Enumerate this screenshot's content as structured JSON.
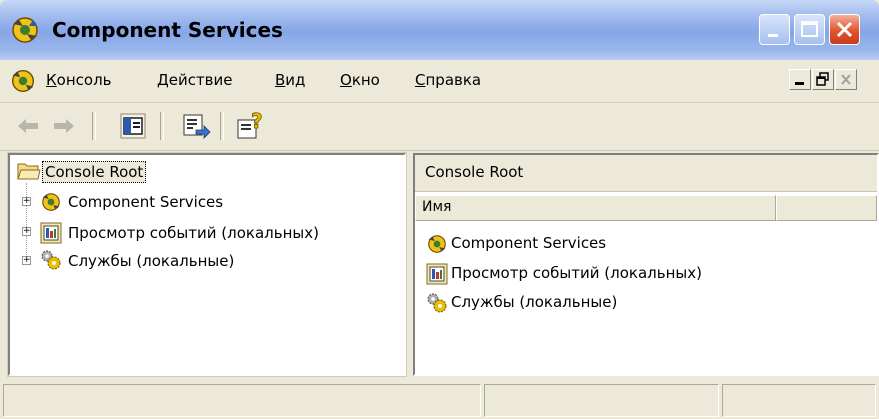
{
  "window": {
    "title": "Component Services",
    "accent": "#8eacea"
  },
  "menubar": {
    "items": [
      {
        "first": "К",
        "rest": "онсоль"
      },
      {
        "first": "Д",
        "rest": "ействие"
      },
      {
        "first": "В",
        "rest": "ид"
      },
      {
        "first": "О",
        "rest": "кно"
      },
      {
        "first": "С",
        "rest": "правка"
      }
    ]
  },
  "toolbar": {
    "icons": [
      "back-arrow-icon",
      "forward-arrow-icon",
      "show-hide-tree-icon",
      "export-list-icon",
      "help-icon"
    ]
  },
  "tree": {
    "root": "Console Root",
    "nodes": [
      {
        "label": "Component Services",
        "icon": "component-services-icon"
      },
      {
        "label": "Просмотр событий (локальных)",
        "icon": "event-viewer-icon"
      },
      {
        "label": "Службы (локальные)",
        "icon": "services-gear-icon"
      }
    ]
  },
  "details": {
    "header": "Console Root",
    "columns": [
      "Имя",
      ""
    ],
    "items": [
      {
        "label": "Component Services",
        "icon": "component-services-icon"
      },
      {
        "label": "Просмотр событий (локальных)",
        "icon": "event-viewer-icon"
      },
      {
        "label": "Службы (локальные)",
        "icon": "services-gear-icon"
      }
    ]
  },
  "statusbar": {
    "segments": [
      "",
      "",
      ""
    ]
  }
}
